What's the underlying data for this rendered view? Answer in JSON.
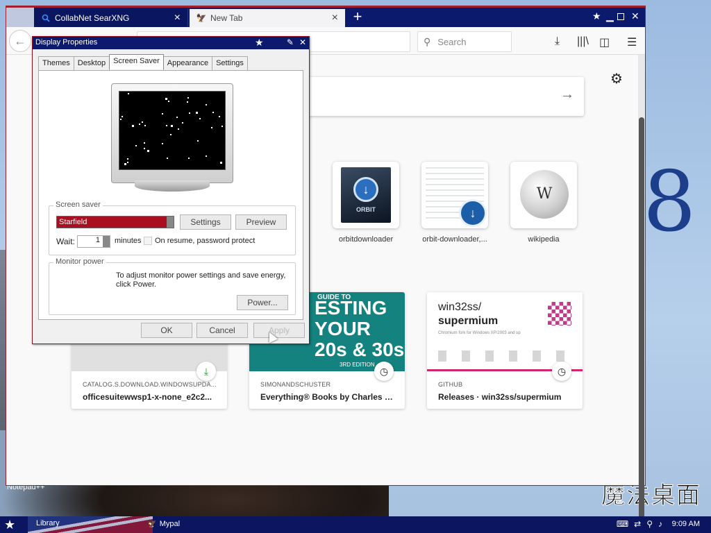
{
  "browser": {
    "tabs": [
      {
        "title": "CollabNet SearXNG",
        "icon": "search-icon",
        "active": false
      },
      {
        "title": "New Tab",
        "icon": "mypal-icon",
        "active": true
      }
    ],
    "search_placeholder": "Search"
  },
  "newtab": {
    "topsites": [
      {
        "label": "orbitdownloader",
        "thumb_text": "ORBIT"
      },
      {
        "label": "orbit-downloader,..."
      },
      {
        "label": "wikipedia"
      }
    ],
    "highlights": [
      {
        "source": "CATALOG.S.DOWNLOAD.WINDOWSUPDA...",
        "title": "officesuitewwsp1-x-none_e2c2...",
        "badge": "download-icon"
      },
      {
        "source": "SIMONANDSCHUSTER",
        "title": "Everything® Books by Charles Ti...",
        "badge": "clock-icon",
        "image_lines": [
          "GUIDE TO",
          "ESTING",
          "YOUR",
          "20s & 30s",
          "3RD EDITION"
        ]
      },
      {
        "source": "GITHUB",
        "title": "Releases · win32ss/supermium",
        "badge": "clock-icon",
        "image_title": "win32ss/",
        "image_title_bold": "supermium",
        "image_sub": "Chromium fork for Windows XP/2003 and up"
      }
    ]
  },
  "dialog": {
    "title": "Display Properties",
    "tabs": [
      "Themes",
      "Desktop",
      "Screen Saver",
      "Appearance",
      "Settings"
    ],
    "active_tab": "Screen Saver",
    "screensaver": {
      "group_label": "Screen saver",
      "selected": "Starfield",
      "settings_label": "Settings",
      "preview_label": "Preview",
      "wait_label": "Wait:",
      "wait_value": "1",
      "minutes_label": "minutes",
      "resume_label": "On resume, password protect"
    },
    "monitor_power": {
      "group_label": "Monitor power",
      "text": "To adjust monitor power settings and save energy, click Power.",
      "power_label": "Power..."
    },
    "ok_label": "OK",
    "cancel_label": "Cancel",
    "apply_label": "Apply"
  },
  "desktop": {
    "notepad_label": "Notepad++",
    "big_glyph": "8",
    "calligraphy": "魔法桌面"
  },
  "taskbar": {
    "items": [
      "Library",
      "Mypal"
    ],
    "clock": "9:09 AM"
  }
}
